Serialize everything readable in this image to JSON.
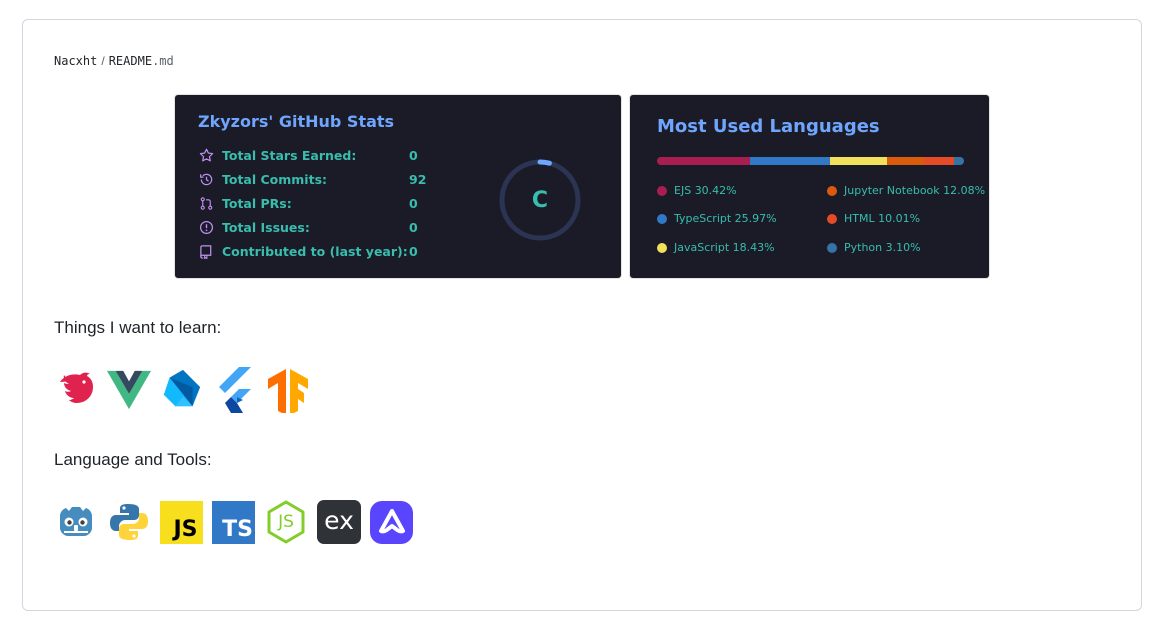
{
  "breadcrumb": {
    "user": "Nacxht",
    "separator": "/",
    "file_name": "README",
    "file_ext": ".md"
  },
  "stats_card": {
    "title": "Zkyzors' GitHub Stats",
    "rows": [
      {
        "icon": "star-icon",
        "label": "Total Stars Earned:",
        "value": "0"
      },
      {
        "icon": "history-icon",
        "label": "Total Commits:",
        "value": "92"
      },
      {
        "icon": "pull-request-icon",
        "label": "Total PRs:",
        "value": "0"
      },
      {
        "icon": "issue-icon",
        "label": "Total Issues:",
        "value": "0"
      },
      {
        "icon": "repo-icon",
        "label": "Contributed to (last year):",
        "value": "0"
      }
    ],
    "rank": "C",
    "rank_progress": 0.04,
    "colors": {
      "title": "#70a5fd",
      "text": "#38bdae",
      "icon": "#bf91f3",
      "bg": "#1a1b27",
      "ring_track": "#2b3452",
      "ring": "#70a5fd"
    }
  },
  "languages_card": {
    "title": "Most Used Languages",
    "languages": [
      {
        "name": "EJS",
        "percent": "30.42%",
        "value": 30.42,
        "color": "#a91e50"
      },
      {
        "name": "TypeScript",
        "percent": "25.97%",
        "value": 25.97,
        "color": "#3178c6"
      },
      {
        "name": "JavaScript",
        "percent": "18.43%",
        "value": 18.43,
        "color": "#f1e05a"
      },
      {
        "name": "Jupyter Notebook",
        "percent": "12.08%",
        "value": 12.08,
        "color": "#da5b0b"
      },
      {
        "name": "HTML",
        "percent": "10.01%",
        "value": 10.01,
        "color": "#e34c26"
      },
      {
        "name": "Python",
        "percent": "3.10%",
        "value": 3.1,
        "color": "#3572a5"
      }
    ]
  },
  "learn": {
    "heading": "Things I want to learn:",
    "icons": [
      "nestjs-icon",
      "vue-icon",
      "dart-icon",
      "flutter-icon",
      "tensorflow-icon"
    ]
  },
  "tools": {
    "heading": "Language and Tools:",
    "icons": [
      {
        "name": "godot-icon"
      },
      {
        "name": "python-icon"
      },
      {
        "name": "javascript-icon",
        "text": "JS"
      },
      {
        "name": "typescript-icon",
        "text": "TS"
      },
      {
        "name": "nodejs-icon",
        "text": "JS"
      },
      {
        "name": "express-icon",
        "text": "ex"
      },
      {
        "name": "adonisjs-icon"
      }
    ]
  }
}
